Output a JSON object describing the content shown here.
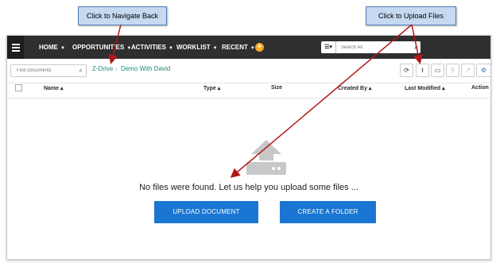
{
  "callouts": {
    "navigate_back": "Click to Navigate Back",
    "upload_files": "Click to Upload Files"
  },
  "navbar": {
    "items": [
      {
        "label": "HOME"
      },
      {
        "label": "OPPORTUNITIES"
      },
      {
        "label": "ACTIVITIES"
      },
      {
        "label": "WORKLIST"
      },
      {
        "label": "RECENT"
      }
    ],
    "search_placeholder": "Search All"
  },
  "toolbar": {
    "find_placeholder": "Find Documents",
    "breadcrumb": [
      "Z-Drive",
      "Demo With David"
    ]
  },
  "table": {
    "columns": [
      "Name",
      "Type",
      "Size",
      "Created By",
      "Last Modified",
      "Action"
    ]
  },
  "empty_state": {
    "message": "No files were found. Let us help you upload some files ...",
    "upload_button": "UPLOAD DOCUMENT",
    "folder_button": "CREATE A FOLDER"
  },
  "colors": {
    "navbar": "#2f2f2f",
    "accent": "#1a76d2",
    "breadcrumb": "#1f8a7a",
    "plus": "#f5a623",
    "callout_fill": "#c5d9f1",
    "arrow": "#b01818"
  },
  "icons": [
    "hamburger-icon",
    "plus-icon",
    "search-icon",
    "refresh-icon",
    "upload-icon",
    "folder-icon",
    "link-icon",
    "share-icon",
    "settings-icon",
    "upload-cloud-icon"
  ]
}
